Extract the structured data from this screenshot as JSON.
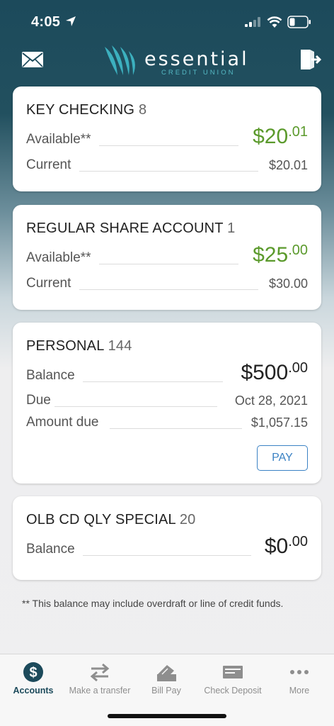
{
  "status": {
    "time": "4:05"
  },
  "brand": {
    "name": "essential",
    "sub": "CREDIT UNION"
  },
  "colors": {
    "accent_green": "#5b9a2c",
    "header_teal": "#1c4a5b",
    "pay_blue": "#3b82c4"
  },
  "accounts": [
    {
      "name": "KEY CHECKING",
      "number": "8",
      "rows": [
        {
          "label": "Available**",
          "dollars": "$20",
          "cents": ".01"
        },
        {
          "label": "Current",
          "value": "$20.01"
        }
      ]
    },
    {
      "name": "REGULAR SHARE ACCOUNT",
      "number": "1",
      "rows": [
        {
          "label": "Available**",
          "dollars": "$25",
          "cents": ".00"
        },
        {
          "label": "Current",
          "value": "$30.00"
        }
      ]
    },
    {
      "name": "PERSONAL",
      "number": "144",
      "rows": [
        {
          "label": "Balance",
          "dollars": "$500",
          "cents": ".00"
        },
        {
          "label": "Due",
          "value": "Oct 28, 2021"
        },
        {
          "label": "Amount due",
          "value": "$1,057.15"
        }
      ],
      "pay_label": "PAY"
    },
    {
      "name": "OLB CD QLY SPECIAL",
      "number": "20",
      "rows": [
        {
          "label": "Balance",
          "dollars": "$0",
          "cents": ".00"
        }
      ]
    }
  ],
  "footnote": "** This balance may include overdraft or line of credit funds.",
  "tabs": [
    {
      "label": "Accounts",
      "icon": "dollar-circle-icon"
    },
    {
      "label": "Make a transfer",
      "icon": "transfer-arrows-icon"
    },
    {
      "label": "Bill Pay",
      "icon": "bill-pay-icon"
    },
    {
      "label": "Check Deposit",
      "icon": "check-icon"
    },
    {
      "label": "More",
      "icon": "more-dots-icon"
    }
  ]
}
